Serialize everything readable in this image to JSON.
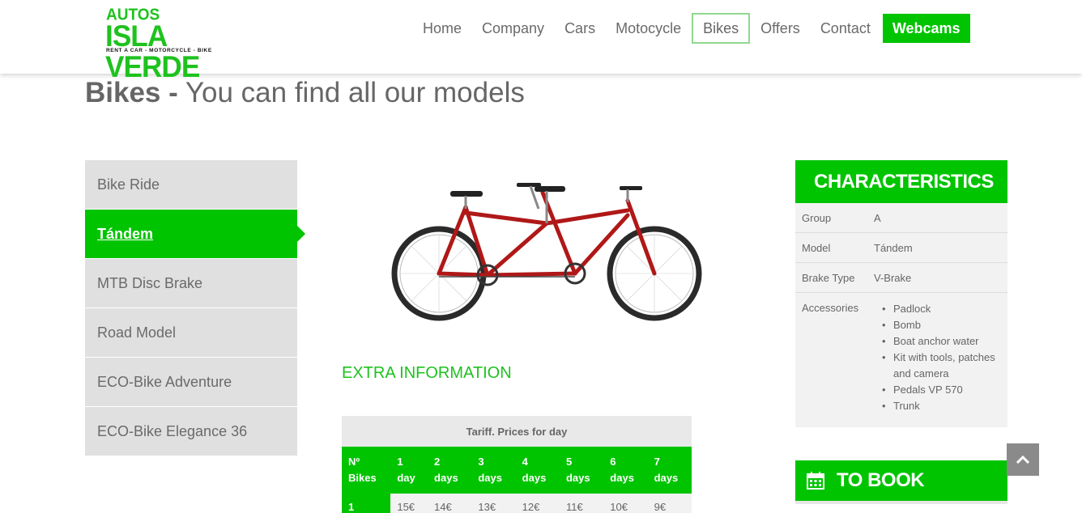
{
  "brand": {
    "line1": "AUTOS",
    "line2": "ISLA VERDE",
    "tagline": "RENT A CAR - MOTORCYCLE - BIKE"
  },
  "nav": {
    "home": "Home",
    "company": "Company",
    "cars": "Cars",
    "motocycle": "Motocycle",
    "bikes": "Bikes",
    "offers": "Offers",
    "contact": "Contact",
    "webcams": "Webcams"
  },
  "page": {
    "title_bold": "Bikes -",
    "title_rest": "You can find all our models"
  },
  "sidebar": {
    "items": [
      {
        "label": "Bike Ride"
      },
      {
        "label": "Tándem"
      },
      {
        "label": "MTB Disc Brake"
      },
      {
        "label": "Road Model"
      },
      {
        "label": "ECO-Bike Adventure"
      },
      {
        "label": "ECO-Bike Elegance 36"
      }
    ]
  },
  "extra": {
    "title": "EXTRA INFORMATION",
    "tariff_caption": "Tariff. Prices for day",
    "headers": [
      [
        "Nº",
        "Bikes"
      ],
      [
        "1",
        "day"
      ],
      [
        "2",
        "days"
      ],
      [
        "3",
        "days"
      ],
      [
        "4",
        "days"
      ],
      [
        "5",
        "days"
      ],
      [
        "6",
        "days"
      ],
      [
        "7",
        "days"
      ]
    ],
    "rows": [
      [
        "1",
        "15€",
        "14€",
        "13€",
        "12€",
        "11€",
        "10€",
        "9€"
      ]
    ]
  },
  "characteristics": {
    "title": "CHARACTERISTICS",
    "group_label": "Group",
    "group_value": "A",
    "model_label": "Model",
    "model_value": "Tándem",
    "brake_label": "Brake Type",
    "brake_value": "V-Brake",
    "accessories_label": "Accessories",
    "accessories": [
      "Padlock",
      "Bomb",
      "Boat anchor water",
      "Kit with tools, patches and camera",
      "Pedals VP 570",
      "Trunk"
    ]
  },
  "book": {
    "label": "TO BOOK",
    "icon": "calendar-icon"
  },
  "scroll": {
    "icon": "chevron-up-icon"
  },
  "colors": {
    "accent": "#00c400",
    "text": "#666666",
    "panel": "#e0e0e0",
    "bike": "#b01818"
  }
}
